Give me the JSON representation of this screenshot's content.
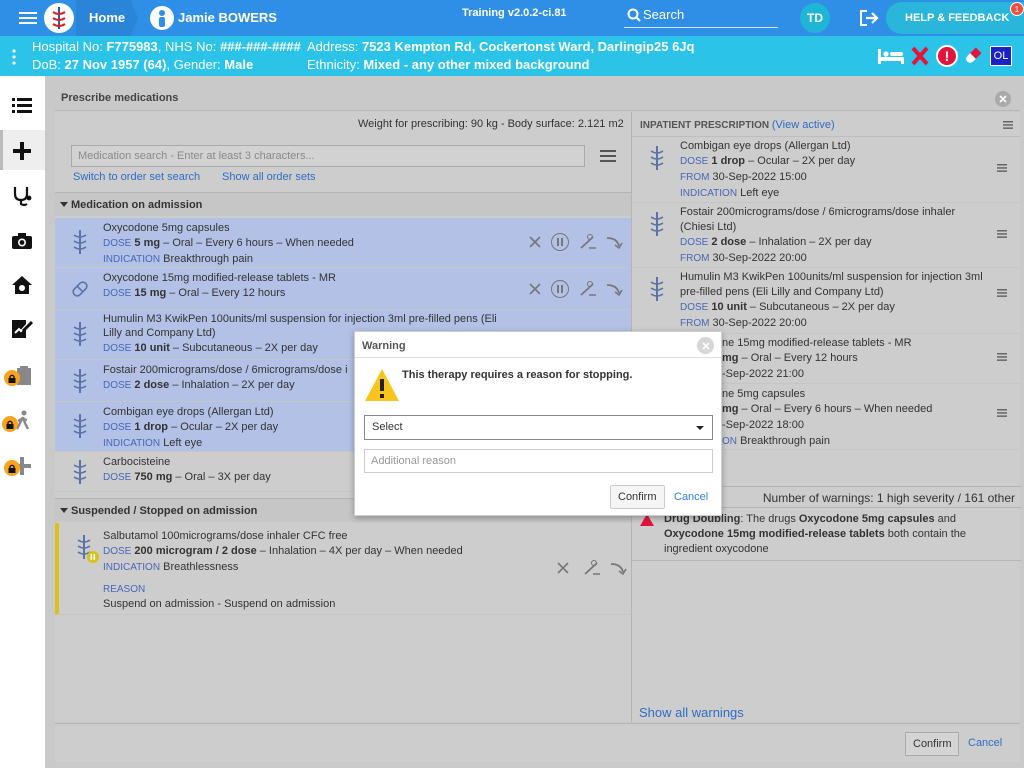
{
  "topbar": {
    "home": "Home",
    "patient_name": "Jamie BOWERS",
    "training": "Training v2.0.2-ci.81",
    "search": "Search",
    "initials": "TD",
    "help": "HELP & FEEDBACK",
    "help_badge": "1"
  },
  "patient": {
    "hospital_label": "Hospital No:",
    "hospital_no": "F775983",
    "nhs_label": "NHS No:",
    "nhs_no": "###-###-####",
    "address_label": "Address:",
    "address": "7523 Kempton Rd, Cockertonst Ward, Darlingip25 6Jq",
    "dob_label": "DoB:",
    "dob": "27 Nov 1957 (64)",
    "gender_label": "Gender:",
    "gender": "Male",
    "ethnicity_label": "Ethnicity:",
    "ethnicity": "Mixed - any other mixed background",
    "ol_badge": "OL"
  },
  "panel": {
    "title": "Prescribe medications",
    "weight": "Weight for prescribing: 90 kg - Body surface: 2.121 m2",
    "search_placeholder": "Medication search - Enter at least 3 characters...",
    "order_set_link": "Switch to order set search",
    "all_sets_link": "Show all order sets",
    "section_admission": "Medication on admission",
    "section_suspended": "Suspended / Stopped on admission",
    "confirm": "Confirm",
    "cancel": "Cancel"
  },
  "labels": {
    "dose": "DOSE",
    "indication": "INDICATION",
    "reason": "REASON",
    "from": "FROM"
  },
  "admission_meds": [
    {
      "name": "Oxycodone 5mg capsules",
      "dose": "5 mg",
      "detail": " – Oral – Every 6 hours – When needed",
      "indication": "Breakthrough pain"
    },
    {
      "name": "Oxycodone 15mg modified-release tablets - MR",
      "dose": "15 mg",
      "detail": " – Oral – Every 12 hours",
      "indication": ""
    },
    {
      "name": "Humulin M3 KwikPen 100units/ml suspension for injection 3ml pre-filled pens (Eli",
      "name2": "Lilly and Company Ltd)",
      "dose": "10 unit",
      "detail": " – Subcutaneous – 2X per day",
      "indication": ""
    },
    {
      "name": "Fostair 200micrograms/dose / 6micrograms/dose i",
      "dose": "2 dose",
      "detail": " – Inhalation – 2X per day",
      "indication": ""
    },
    {
      "name": "Combigan eye drops (Allergan Ltd)",
      "dose": "1 drop",
      "detail": " – Ocular – 2X per day",
      "indication": "Left eye"
    },
    {
      "name": "Carbocisteine",
      "dose": "750 mg",
      "detail": " – Oral – 3X per day",
      "indication": ""
    }
  ],
  "suspended_med": {
    "name": "Salbutamol 100micrograms/dose inhaler CFC free",
    "dose": "200 microgram / 2 dose",
    "detail": " – Inhalation – 4X per day – When needed",
    "indication": "Breathlessness",
    "reason": "Suspend on admission - Suspend on admission"
  },
  "inpatient": {
    "title": "INPATIENT PRESCRIPTION",
    "view_active": "(View active)",
    "items": [
      {
        "name": "Combigan eye drops (Allergan Ltd)",
        "dose": "1 drop",
        "detail": " – Ocular – 2X per day",
        "from": "30-Sep-2022 15:00",
        "indication": "Left eye"
      },
      {
        "name": "Fostair 200micrograms/dose / 6micrograms/dose inhaler",
        "name2": "(Chiesi Ltd)",
        "dose": "2 dose",
        "detail": " – Inhalation – 2X per day",
        "from": "30-Sep-2022 20:00"
      },
      {
        "name": "Humulin M3 KwikPen 100units/ml suspension for injection 3ml",
        "name2": "pre-filled pens (Eli Lilly and Company Ltd)",
        "dose": "10 unit",
        "detail": " – Subcutaneous – 2X per day",
        "from": "30-Sep-2022 20:00"
      },
      {
        "name": "ne 15mg modified-release tablets - MR",
        "dose": "mg",
        "detail": " – Oral – Every 12 hours",
        "from": "-Sep-2022 21:00"
      },
      {
        "name": "ne 5mg capsules",
        "dose": "mg",
        "detail": " – Oral – Every 6 hours – When needed",
        "from": "-Sep-2022 18:00",
        "indication": "Breakthrough pain",
        "ind_label": "ON"
      }
    ]
  },
  "warnings": {
    "count": "Number of warnings: 1 high severity / 161 other",
    "lead": "Drug Doubling",
    "text1": ": The drugs ",
    "drug1": "Oxycodone 5mg capsules",
    "text2": " and",
    "drug2": "Oxycodone 15mg modified-release tablets",
    "text3": " both contain the",
    "text4": "ingredient oxycodone",
    "show_all": "Show all warnings"
  },
  "dialog": {
    "title": "Warning",
    "message": "This therapy requires a reason for stopping.",
    "select_value": "Select",
    "reason_placeholder": "Additional reason",
    "confirm": "Confirm",
    "cancel": "Cancel"
  },
  "colors": {
    "topbar": "#2f8fe6",
    "patient_bar": "#2bc3e8",
    "selected_row": "#b3c1e6",
    "danger": "#e3143c",
    "link": "#2f7fd6",
    "lock_badge": "#f7a41c"
  }
}
